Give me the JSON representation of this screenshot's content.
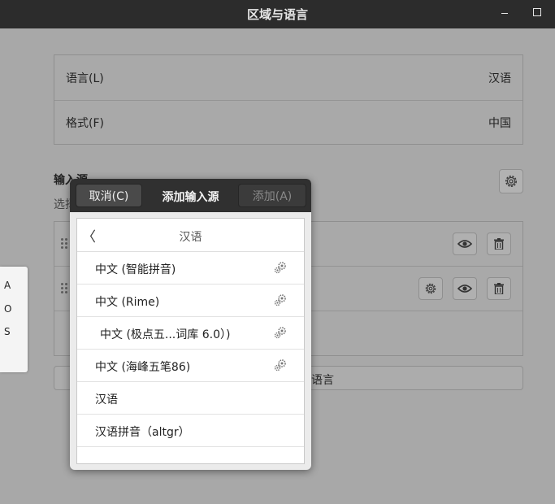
{
  "window": {
    "title": "区域与语言"
  },
  "settings": {
    "language": {
      "label": "语言(L)",
      "value": "汉语"
    },
    "format": {
      "label": "格式(F)",
      "value": "中国"
    }
  },
  "input_sources": {
    "title": "输入源",
    "subtitle": "选择"
  },
  "manage_languages_label": "语言",
  "osk_keys": [
    "A",
    "O",
    "S"
  ],
  "dialog": {
    "cancel_label": "取消(C)",
    "title": "添加输入源",
    "add_label": "添加(A)",
    "list_title": "汉语",
    "items": [
      {
        "label": "中文 (智能拼音)",
        "configurable": true
      },
      {
        "label": "中文 (Rime)",
        "configurable": true
      },
      {
        "label": "中文 (极点五...词库 6.0）)",
        "configurable": true
      },
      {
        "label": "中文 (海峰五笔86)",
        "configurable": true
      },
      {
        "label": "汉语",
        "configurable": false
      },
      {
        "label": "汉语拼音（altgr）",
        "configurable": false
      }
    ]
  },
  "icons": {
    "back": "chevron-left-icon",
    "configure": "gears-icon",
    "preview": "eye-icon",
    "remove": "trash-icon",
    "settings": "gear-icon",
    "drag": "drag-handle-icon"
  }
}
